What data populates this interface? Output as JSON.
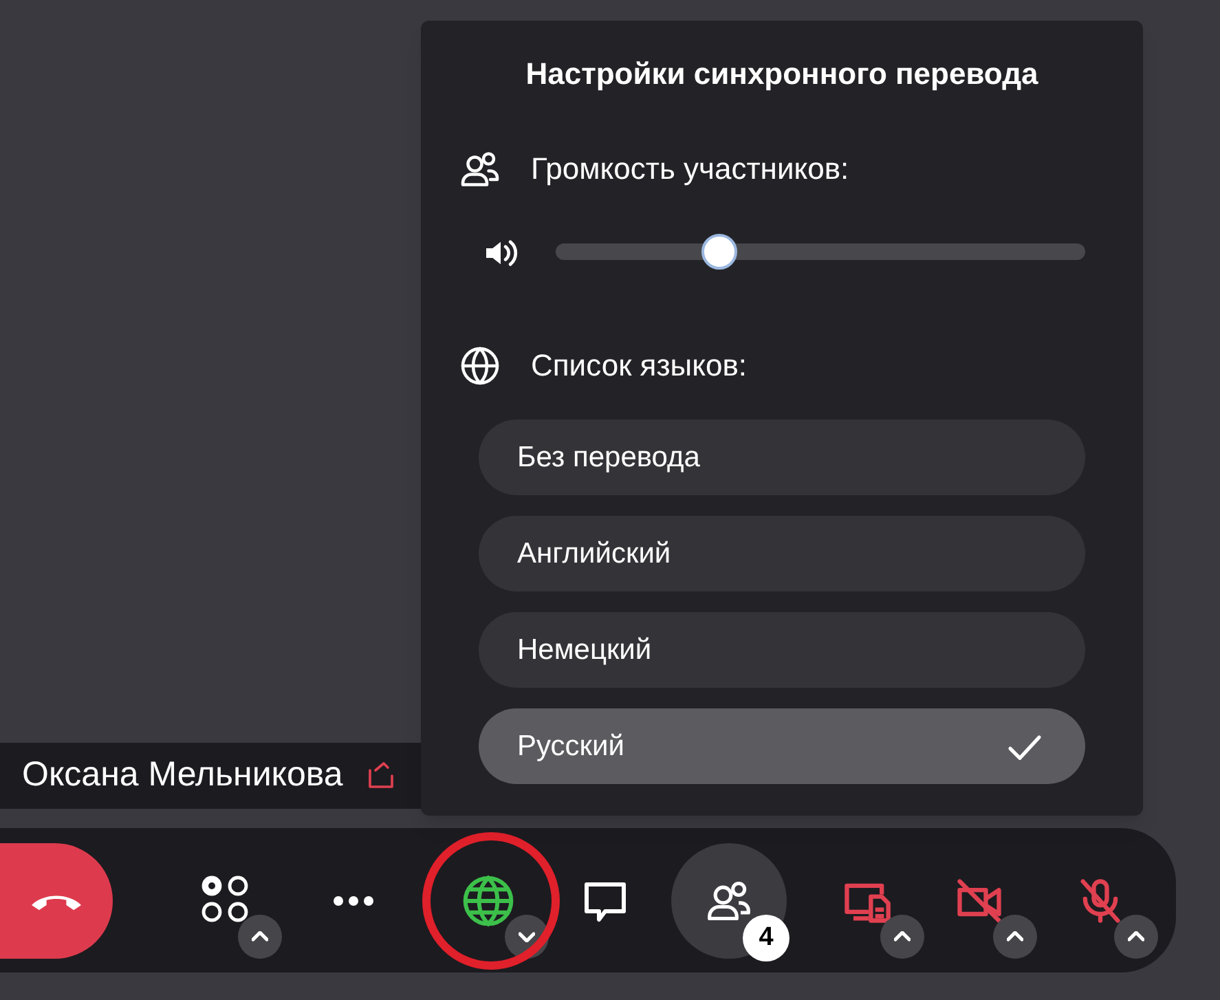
{
  "translation_panel": {
    "title": "Настройки синхронного перевода",
    "volume_label": "Громкость участников:",
    "volume": {
      "level": 0.31
    },
    "languages_label": "Список языков:",
    "languages": [
      {
        "label": "Без перевода",
        "selected": false
      },
      {
        "label": "Английский",
        "selected": false
      },
      {
        "label": "Немецкий",
        "selected": false
      },
      {
        "label": "Русский",
        "selected": true
      }
    ]
  },
  "speaker": {
    "name": "Оксана Мельникова"
  },
  "toolbar": {
    "buttons": [
      {
        "kind": "hangup",
        "off": false,
        "active": false,
        "highlighted": false
      },
      {
        "kind": "layout",
        "menu": {
          "open": false
        },
        "off": false,
        "active": false,
        "highlighted": false
      },
      {
        "kind": "more",
        "off": false,
        "active": false,
        "highlighted": false
      },
      {
        "kind": "translation",
        "menu": {
          "open": true
        },
        "off": false,
        "active": true,
        "highlighted": true
      },
      {
        "kind": "chat",
        "off": false,
        "active": false,
        "highlighted": false
      },
      {
        "kind": "participants",
        "badge": "4",
        "off": false,
        "active": false,
        "highlighted": false
      },
      {
        "kind": "share",
        "menu": {
          "open": false
        },
        "off": true,
        "active": false,
        "highlighted": false
      },
      {
        "kind": "camera",
        "menu": {
          "open": false
        },
        "off": true,
        "active": false,
        "highlighted": false
      },
      {
        "kind": "microphone",
        "menu": {
          "open": false
        },
        "off": true,
        "active": false,
        "highlighted": false
      }
    ]
  }
}
